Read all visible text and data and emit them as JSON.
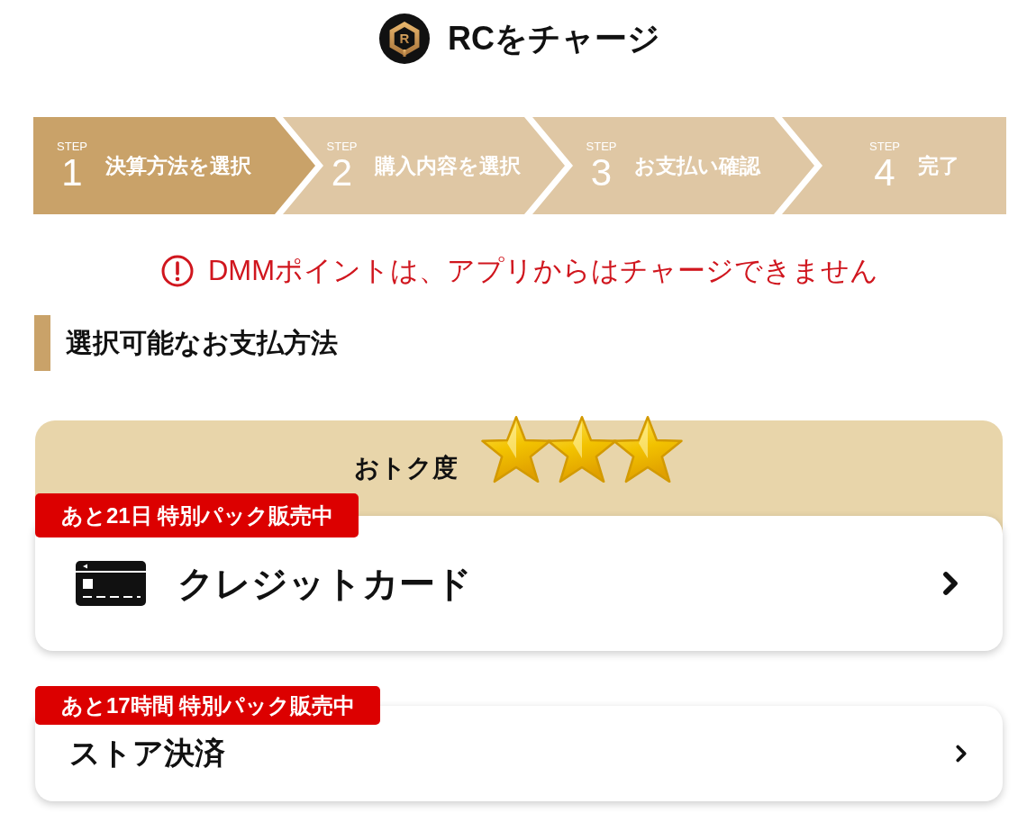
{
  "header": {
    "logo_letter": "R",
    "title": "RCをチャージ"
  },
  "steps": [
    {
      "caption": "STEP",
      "number": "1",
      "label": "決算方法を選択",
      "selected": true
    },
    {
      "caption": "STEP",
      "number": "2",
      "label": "購入内容を選択",
      "selected": false
    },
    {
      "caption": "STEP",
      "number": "3",
      "label": "お支払い確認",
      "selected": false
    },
    {
      "caption": "STEP",
      "number": "4",
      "label": "完了",
      "selected": false
    }
  ],
  "notice": "DMMポイントは、アプリからはチャージできません",
  "section": {
    "title": "選択可能なお支払方法"
  },
  "payment_methods": [
    {
      "kind": "featured",
      "rating_label": "おトク度",
      "stars": 3,
      "badge": "あと21日 特別パック販売中",
      "name": "クレジットカード"
    },
    {
      "kind": "plain",
      "badge": "あと17時間 特別パック販売中",
      "name": "ストア決済"
    }
  ]
}
